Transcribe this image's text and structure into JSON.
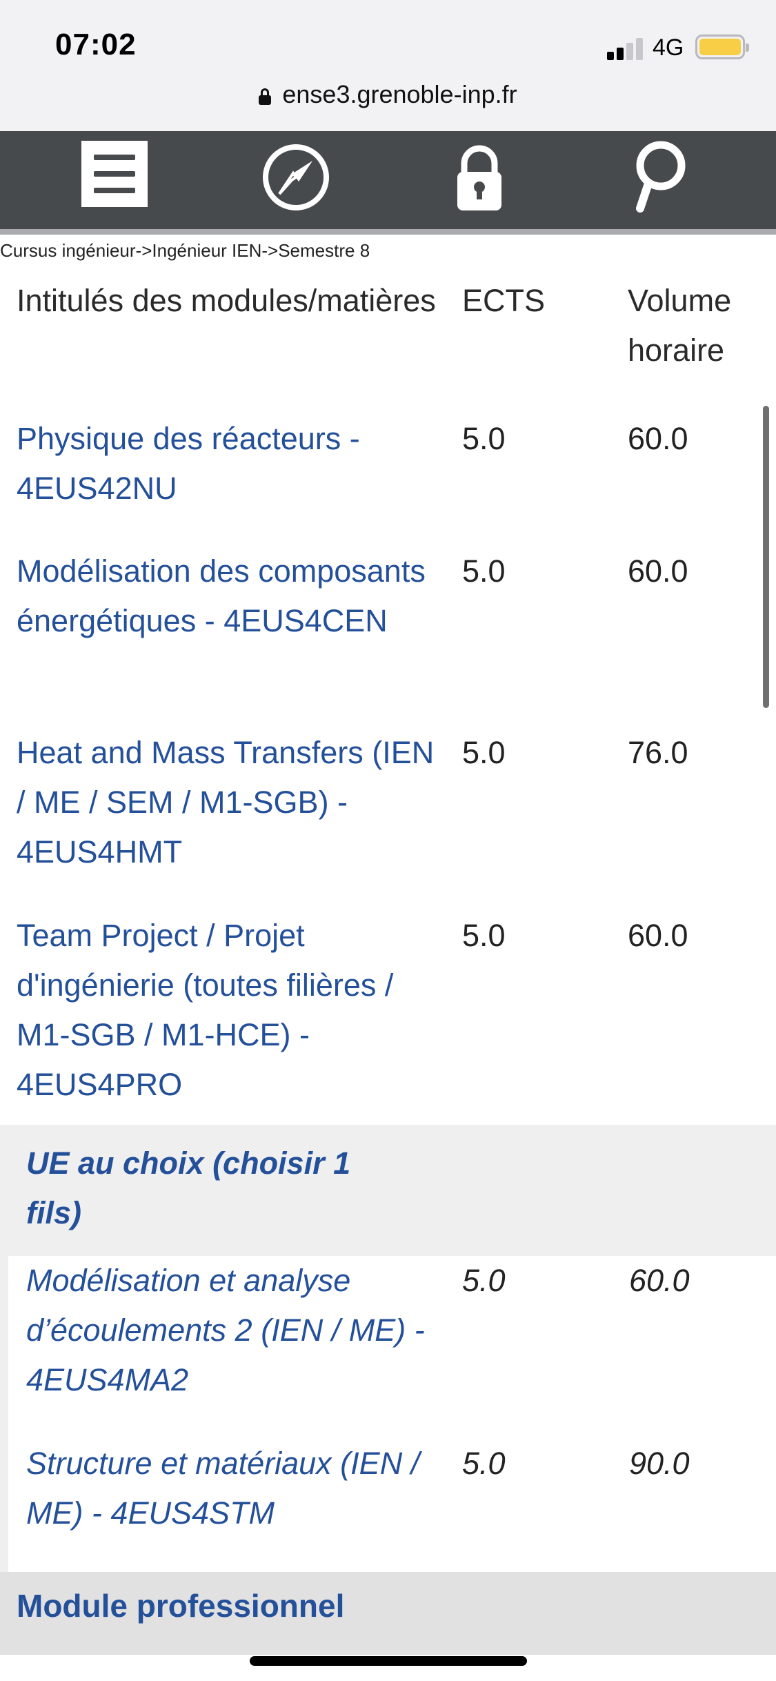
{
  "status_bar": {
    "time": "07:02",
    "network": "4G"
  },
  "browser": {
    "url": "ense3.grenoble-inp.fr"
  },
  "nav": {
    "icons": [
      "menu-icon",
      "compass-icon",
      "lock-icon",
      "search-icon"
    ]
  },
  "breadcrumb": "Cursus ingénieur->Ingénieur IEN->Semestre 8",
  "table": {
    "headers": {
      "name": "Intitulés des modules/matières",
      "ects": "ECTS",
      "volume": "Volume horaire"
    },
    "rows": [
      {
        "name": "Physique des réacteurs - 4EUS42NU",
        "ects": "5.0",
        "volume": "60.0"
      },
      {
        "name": "Modélisation des composants énergétiques - 4EUS4CEN",
        "ects": "5.0",
        "volume": "60.0"
      },
      {
        "name": "Heat and Mass Transfers (IEN / ME / SEM / M1-SGB) - 4EUS4HMT",
        "ects": "5.0",
        "volume": "76.0"
      },
      {
        "name": "Team Project / Projet d'ingénierie (toutes filières / M1-SGB / M1-HCE) - 4EUS4PRO",
        "ects": "5.0",
        "volume": "60.0"
      }
    ],
    "choice_group": {
      "title": "UE au choix (choisir 1 fils)",
      "rows": [
        {
          "name": "Modélisation et analyse d’écoulements 2 (IEN / ME) - 4EUS4MA2",
          "ects": "5.0",
          "volume": "60.0"
        },
        {
          "name": "Structure et matériaux (IEN / ME) - 4EUS4STM",
          "ects": "5.0",
          "volume": "90.0"
        }
      ]
    },
    "module_section": "Module professionnel"
  }
}
